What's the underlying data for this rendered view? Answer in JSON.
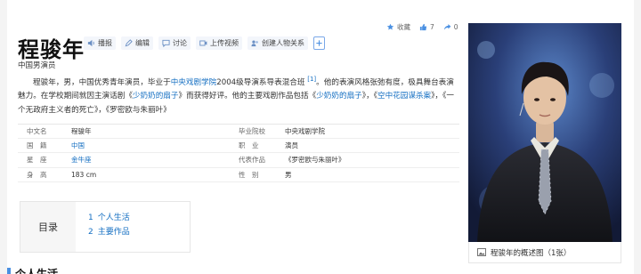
{
  "person": {
    "name": "程骏年",
    "subtitle": "中国男演员"
  },
  "toolbar": {
    "items": [
      {
        "label": "播报",
        "icon": "speaker-icon"
      },
      {
        "label": "编辑",
        "icon": "edit-icon"
      },
      {
        "label": "讨论",
        "icon": "comment-icon"
      },
      {
        "label": "上传视频",
        "icon": "video-icon"
      },
      {
        "label": "创建人物关系",
        "icon": "relation-icon"
      }
    ]
  },
  "actions": {
    "favorite": "收藏",
    "like_count": "7",
    "share_count": "0"
  },
  "summary": {
    "s1": "程骏年，男，中国优秀青年演员，毕业于",
    "link1": "中央戏剧学院",
    "s2": "2004级导演系导表混合班",
    "ref": "[1]",
    "s3": "。他的表演风格张弛有度，极具舞台表演魅力。在学校期间就因主演话剧《",
    "link2": "少奶奶的扇子",
    "s4": "》而获得好评。他的主要戏剧作品包括《",
    "link3": "少奶奶的扇子",
    "s5": "》，《",
    "link4": "空中花园谋杀案",
    "s6": "》，《一个无政府主义者的死亡》，《罗密欧与朱丽叶》"
  },
  "info": [
    {
      "k1": "中文名",
      "v1": "程骏年",
      "k2": "毕业院校",
      "v2": "中央戏剧学院"
    },
    {
      "k1": "国　籍",
      "v1": "中国",
      "k2": "职　业",
      "v2": "演员"
    },
    {
      "k1": "星　座",
      "v1": "金牛座",
      "k2": "代表作品",
      "v2": "《罗密欧与朱丽叶》"
    },
    {
      "k1": "身　高",
      "v1": "183 cm",
      "k2": "性　别",
      "v2": "男"
    }
  ],
  "toc": {
    "title": "目录",
    "items": [
      {
        "num": "1",
        "label": "个人生活"
      },
      {
        "num": "2",
        "label": "主要作品"
      }
    ]
  },
  "section": {
    "title": "个人生活"
  },
  "photo": {
    "caption": "程骏年的概述图（1张）"
  },
  "colors": {
    "link": "#136ec2",
    "accent": "#4a90e2",
    "photo_bg": "#1a2240"
  }
}
